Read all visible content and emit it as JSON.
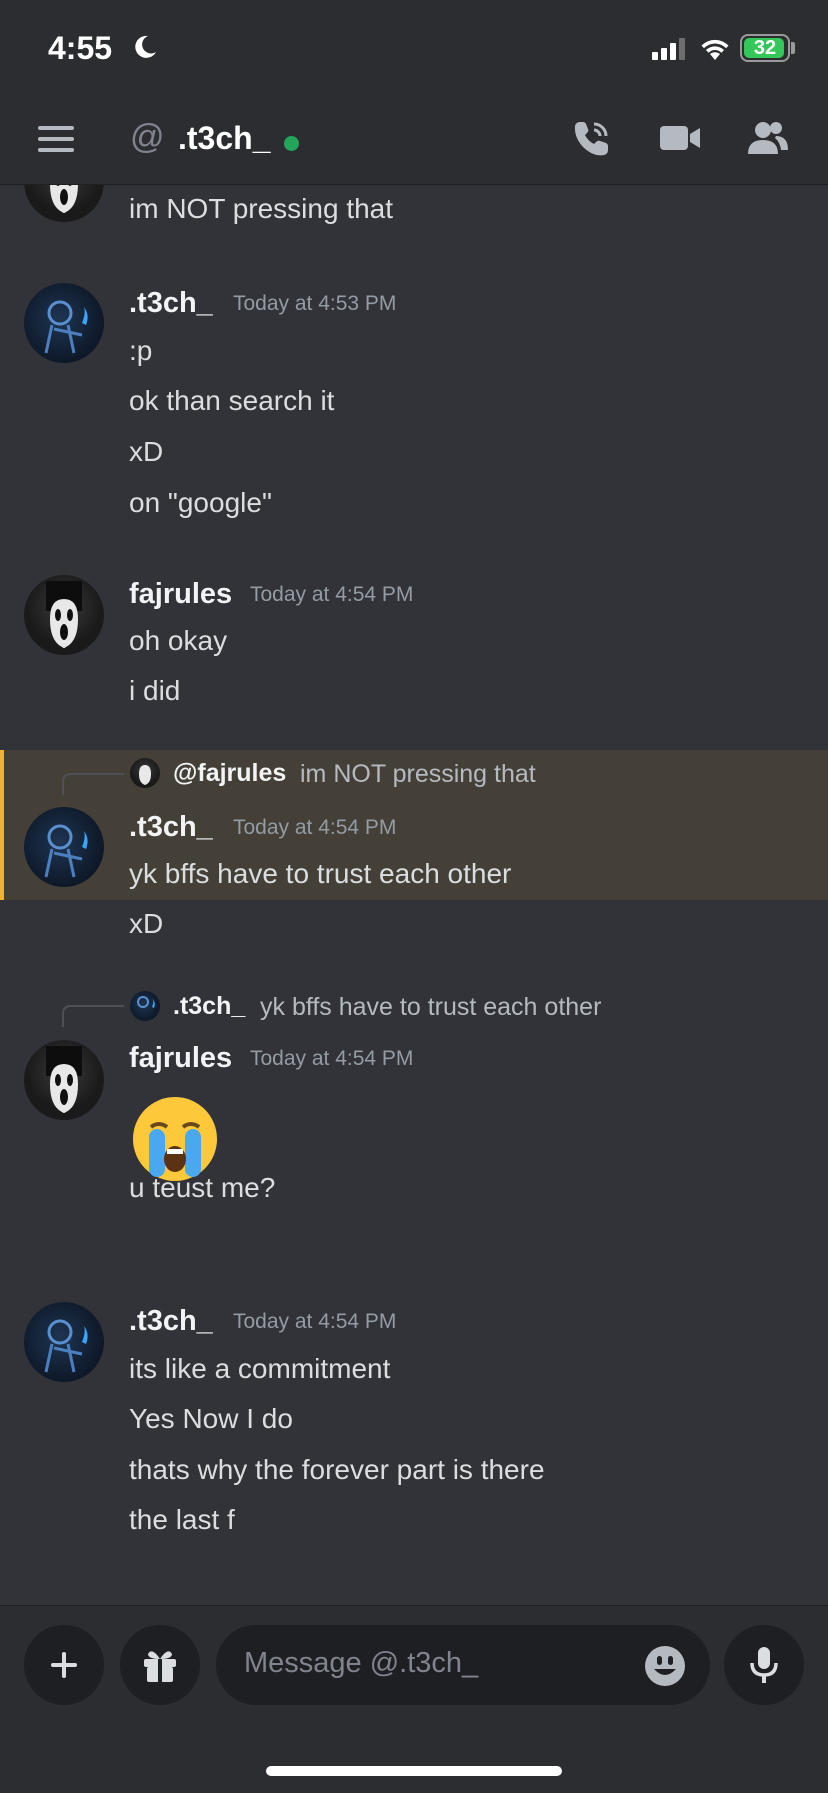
{
  "status_bar": {
    "time": "4:55",
    "battery": "32"
  },
  "header": {
    "channel": ".t3ch_"
  },
  "messages": {
    "top_line": "im NOT pressing that",
    "g1": {
      "user": ".t3ch_",
      "time": "Today at 4:53 PM",
      "lines": [
        ":p",
        "ok than search it",
        "xD",
        "on \"google\""
      ]
    },
    "g2": {
      "user": "fajrules",
      "time": "Today at 4:54 PM",
      "lines": [
        "oh okay",
        "i did"
      ]
    },
    "g3": {
      "reply_user": "@fajrules",
      "reply_text": "im NOT pressing that",
      "user": ".t3ch_",
      "time": "Today at 4:54 PM",
      "lines": [
        "yk bffs have to trust each other",
        "xD"
      ]
    },
    "g4": {
      "reply_user": ".t3ch_",
      "reply_text": "yk bffs have to trust each other",
      "user": "fajrules",
      "time": "Today at 4:54 PM",
      "emoji": "loudly-crying-face",
      "lines": [
        "u teust me?"
      ]
    },
    "g5": {
      "user": ".t3ch_",
      "time": "Today at 4:54 PM",
      "lines": [
        "its like a commitment",
        "Yes Now I do",
        "thats why the forever part is there",
        "the last f"
      ]
    }
  },
  "composer": {
    "placeholder": "Message @.t3ch_"
  },
  "colors": {
    "background": "#313338",
    "header": "#2b2d31",
    "highlight": "#444037",
    "highlight_bar": "#f0b132",
    "online": "#23a55a"
  }
}
